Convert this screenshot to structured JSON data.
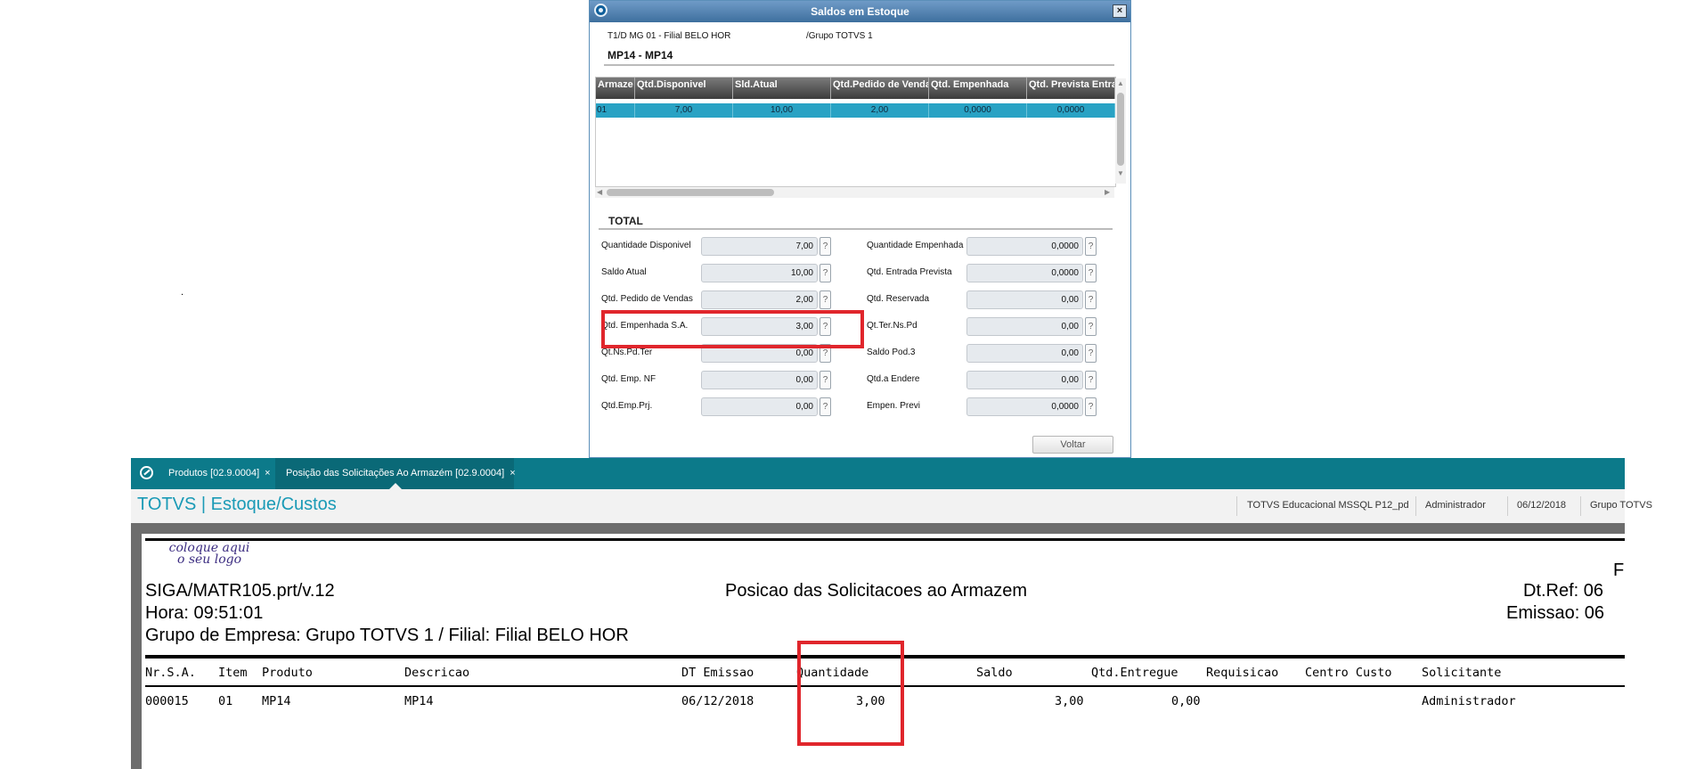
{
  "dialog": {
    "title": "Saldos em Estoque",
    "close_label": "×",
    "filial": "T1/D MG 01  - Filial BELO HOR",
    "grupo": "/Grupo TOTVS 1",
    "product": "MP14 - MP14",
    "grid": {
      "columns": [
        "Armaze",
        "Qtd.Disponivel",
        "Sld.Atual",
        "Qtd.Pedido de Vendas",
        "Qtd. Empenhada",
        "Qtd. Prevista Entrada"
      ],
      "rows": [
        [
          "01",
          "7,00",
          "10,00",
          "2,00",
          "0,0000",
          "0,0000"
        ]
      ]
    },
    "total_label": "TOTAL",
    "fields_left": [
      {
        "label": "Quantidade Disponivel",
        "value": "7,00"
      },
      {
        "label": "Saldo Atual",
        "value": "10,00"
      },
      {
        "label": "Qtd. Pedido de Vendas",
        "value": "2,00"
      },
      {
        "label": "Qtd. Empenhada S.A.",
        "value": "3,00"
      },
      {
        "label": "Qt.Ns.Pd.Ter",
        "value": "0,00"
      },
      {
        "label": "Qtd. Emp. NF",
        "value": "0,00"
      },
      {
        "label": "Qtd.Emp.Prj.",
        "value": "0,00"
      }
    ],
    "fields_right": [
      {
        "label": "Quantidade Empenhada",
        "value": "0,0000"
      },
      {
        "label": "Qtd. Entrada Prevista",
        "value": "0,0000"
      },
      {
        "label": "Qtd. Reservada",
        "value": "0,00"
      },
      {
        "label": "Qt.Ter.Ns.Pd",
        "value": "0,00"
      },
      {
        "label": "Saldo Pod.3",
        "value": "0,00"
      },
      {
        "label": "Qtd.a Endere",
        "value": "0,00"
      },
      {
        "label": "Empen. Previ",
        "value": "0,0000"
      }
    ],
    "help_label": "?",
    "voltar_label": "Voltar",
    "stray_dot": "."
  },
  "app": {
    "tabs": [
      {
        "label": "Produtos [02.9.0004]",
        "close": "×"
      },
      {
        "label": "Posição das Solicitações Ao Armazém [02.9.0004]",
        "close": "×"
      }
    ],
    "title": "TOTVS | Estoque/Custos",
    "info": [
      "TOTVS Educacional MSSQL P12_pd",
      "Administrador",
      "06/12/2018",
      "Grupo TOTVS"
    ]
  },
  "report": {
    "logo_line1": "coloque aqui",
    "logo_line2": "o seu logo",
    "program": "SIGA/MATR105.prt/v.12",
    "hora": "Hora: 09:51:01",
    "grupo": "Grupo de Empresa: Grupo TOTVS 1 / Filial: Filial BELO HOR",
    "title": "Posicao das Solicitacoes ao Armazem",
    "page_fragment": "F",
    "dtref": "Dt.Ref: 06",
    "emissao": "Emissao: 06",
    "columns": [
      "Nr.S.A.",
      "Item",
      "Produto",
      "Descricao",
      "DT Emissao",
      "Quantidade",
      "Saldo",
      "Qtd.Entregue",
      "Requisicao",
      "Centro Custo",
      "Solicitante"
    ],
    "row": [
      "000015",
      "01",
      "MP14",
      "MP14",
      "06/12/2018",
      "3,00",
      "3,00",
      "0,00",
      "",
      "",
      "Administrador"
    ]
  }
}
